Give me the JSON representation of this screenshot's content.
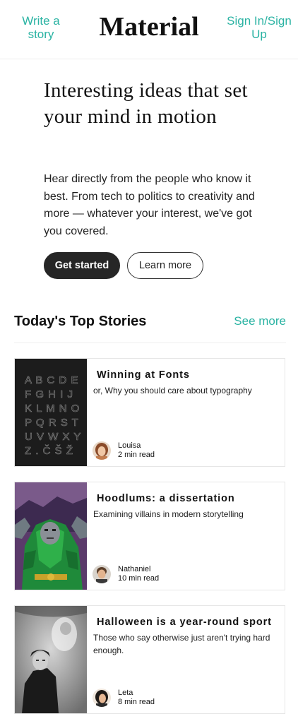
{
  "header": {
    "write_link": "Write a story",
    "logo": "Material",
    "signin_link": "Sign In/Sign Up"
  },
  "hero": {
    "title": "Interesting ideas that set your mind in motion",
    "text": "Hear directly from the people who know it best. From tech to politics to creativity and more — whatever your interest, we've got you covered.",
    "primary_button": "Get started",
    "secondary_button": "Learn more"
  },
  "section": {
    "title": "Today's Top Stories",
    "see_more": "See more"
  },
  "stories": [
    {
      "title": "Winning at Fonts",
      "subtitle": "or, Why you should care about typography",
      "author": "Louisa",
      "read_time": "2 min read",
      "image": "typography-alphabet-art",
      "image_letters": [
        "A B C D E",
        "F G H I J",
        "K L M N O",
        "P Q R S T",
        "U V W X Y",
        "Z . Č Š Ž"
      ]
    },
    {
      "title": "Hoodlums: a dissertation",
      "subtitle": "Examining villains in modern storytelling",
      "author": "Nathaniel",
      "read_time": "10 min read",
      "image": "comic-villain-art"
    },
    {
      "title": "Halloween is a year-round sport",
      "subtitle": "Those who say otherwise just aren't trying hard enough.",
      "author": "Leta",
      "read_time": "8 min read",
      "image": "vintage-ghost-photo"
    }
  ],
  "colors": {
    "accent": "#2ab3a3",
    "primary_button_bg": "#262626",
    "text": "#111111"
  }
}
